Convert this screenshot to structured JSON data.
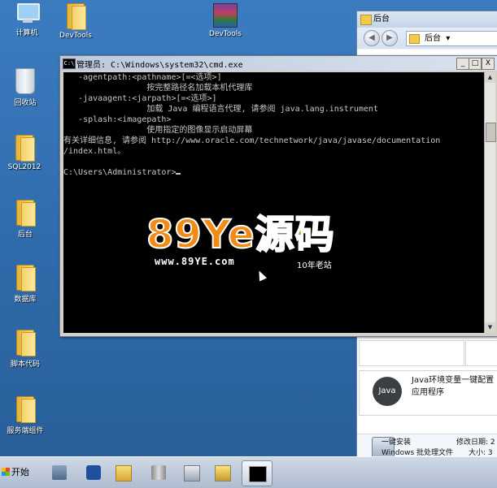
{
  "desktop": {
    "icons": [
      {
        "label": "计算机"
      },
      {
        "label": "DevTools"
      },
      {
        "label": "DevTools"
      },
      {
        "label": "回收站"
      },
      {
        "label": "SQL2012"
      },
      {
        "label": "后台"
      },
      {
        "label": "数据库"
      },
      {
        "label": "脚本代码"
      },
      {
        "label": "服务端组件"
      }
    ]
  },
  "explorer": {
    "title": "后台",
    "address": "后台",
    "nav_back": "◀",
    "nav_forward": "▶",
    "java_tile": {
      "logo": "Java",
      "line1": "Java环境变量一键配置",
      "line2": "应用程序"
    },
    "detail": {
      "name": "一键安装",
      "type": "Windows 批处理文件",
      "modified_label": "修改日期: 2",
      "size_label": "大小: 3"
    }
  },
  "cmd": {
    "title": "管理员: C:\\Windows\\system32\\cmd.exe",
    "icon_text": "C:\\",
    "minimize": "_",
    "maximize": "□",
    "close": "X",
    "lines": [
      "   -agentpath:<pathname>[=<选项>]",
      "                 按完整路径名加载本机代理库",
      "   -javaagent:<jarpath>[=<选项>]",
      "                 加载 Java 编程语言代理, 请参阅 java.lang.instrument",
      "   -splash:<imagepath>",
      "                 使用指定的图像显示启动屏幕",
      "有关详细信息, 请参阅 http://www.oracle.com/technetwork/java/javase/documentation",
      "/index.html。",
      "",
      "C:\\Users\\Administrator>"
    ]
  },
  "watermark": {
    "brand_a": "89Ye",
    "brand_b": "源码",
    "url": "www.89YE.com",
    "slogan": "10年老站"
  },
  "taskbar": {
    "start_label": "开始"
  },
  "colors": {
    "desktop": "#2e6aa9",
    "cmd_bg": "#000000",
    "cmd_fg": "#c8c8c8",
    "watermark_orange": "#f28a16",
    "watermark_green": "#76b82a"
  }
}
